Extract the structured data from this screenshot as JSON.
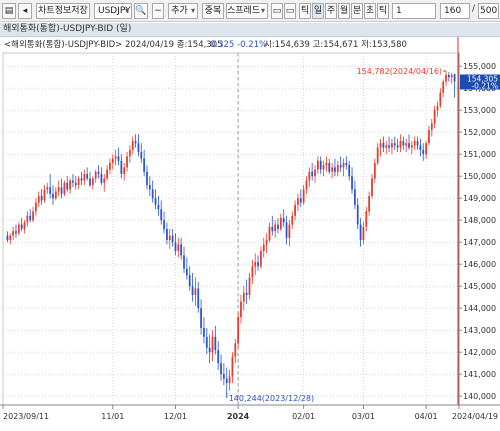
{
  "toolbar": {
    "btn_chart_save": "차트정보저장",
    "symbol": "USDJPY",
    "btn_add": "추가",
    "btn_overlap": "중복",
    "btn_spread": "스프레드",
    "periods": [
      "틱",
      "일",
      "주",
      "월",
      "분",
      "초",
      "틱"
    ],
    "tick_value": "1",
    "count_value": "160",
    "count_sep": "/",
    "count_max": "500"
  },
  "panel_title": "해외통화(통합)-USDJPY-BID (일)",
  "legend": {
    "series": "<해외통화(통합)-USDJPY-BID> 2024/04/19 종:154,305",
    "change": "0.325  -0.21%",
    "ohl": "시:154,639 고:154,671 저:153,580"
  },
  "annotations": {
    "high": "154,782(2024/04/16)",
    "low": "140,244(2023/12/28)"
  },
  "price_tag": {
    "price": "154,305",
    "pct": "-0.21%"
  },
  "colors": {
    "up": "#e23c2e",
    "down": "#2a55c8",
    "tag": "#1d4bb4",
    "cursor": "#d0312d"
  },
  "chart_data": {
    "type": "candlestick",
    "title": "해외통화(통합)-USDJPY-BID (일)",
    "ylim": [
      139.6,
      155.6
    ],
    "yticks": [
      140,
      141,
      142,
      143,
      144,
      145,
      146,
      147,
      148,
      149,
      150,
      151,
      152,
      153,
      154,
      155
    ],
    "ytick_labels": [
      "140,000",
      "141,000",
      "142,000",
      "143,000",
      "144,000",
      "145,000",
      "146,000",
      "147,000",
      "148,000",
      "149,000",
      "150,000",
      "151,000",
      "152,000",
      "153,000",
      "154,000",
      "155,000"
    ],
    "x_labels": [
      {
        "label": "2023/09/11",
        "index": 0
      },
      {
        "label": "11/01",
        "index": 37
      },
      {
        "label": "12/01",
        "index": 59
      },
      {
        "label": "2024",
        "index": 81
      },
      {
        "label": "02/01",
        "index": 104
      },
      {
        "label": "03/01",
        "index": 125
      },
      {
        "label": "04/01",
        "index": 147
      },
      {
        "label": "2024/04/19",
        "index": 160
      }
    ],
    "ohlc": [
      [
        147.3,
        147.5,
        147.0,
        147.1
      ],
      [
        147.1,
        147.4,
        146.9,
        147.3
      ],
      [
        147.3,
        147.7,
        147.1,
        147.5
      ],
      [
        147.5,
        147.8,
        147.2,
        147.4
      ],
      [
        147.4,
        147.9,
        147.3,
        147.8
      ],
      [
        147.8,
        148.1,
        147.5,
        147.6
      ],
      [
        147.6,
        148.0,
        147.4,
        147.9
      ],
      [
        147.9,
        148.4,
        147.7,
        148.2
      ],
      [
        148.2,
        148.5,
        147.9,
        148.0
      ],
      [
        148.0,
        148.6,
        147.9,
        148.4
      ],
      [
        148.4,
        149.0,
        148.2,
        148.8
      ],
      [
        148.8,
        149.3,
        148.6,
        149.1
      ],
      [
        149.1,
        149.4,
        148.7,
        148.9
      ],
      [
        148.9,
        149.6,
        148.8,
        149.4
      ],
      [
        149.4,
        149.7,
        149.2,
        149.5
      ],
      [
        149.5,
        150.1,
        149.0,
        149.2
      ],
      [
        149.2,
        149.6,
        148.7,
        149.0
      ],
      [
        149.0,
        149.5,
        148.9,
        149.3
      ],
      [
        149.3,
        149.8,
        149.1,
        149.5
      ],
      [
        149.5,
        149.9,
        149.0,
        149.2
      ],
      [
        149.2,
        149.8,
        149.1,
        149.7
      ],
      [
        149.7,
        150.0,
        149.3,
        149.4
      ],
      [
        149.4,
        149.9,
        149.2,
        149.8
      ],
      [
        149.8,
        150.1,
        149.5,
        149.7
      ],
      [
        149.7,
        150.0,
        149.4,
        149.6
      ],
      [
        149.6,
        150.0,
        149.4,
        149.9
      ],
      [
        149.9,
        150.2,
        149.6,
        149.8
      ],
      [
        149.8,
        150.3,
        149.6,
        150.1
      ],
      [
        150.1,
        150.4,
        149.8,
        149.9
      ],
      [
        149.9,
        150.2,
        149.5,
        149.6
      ],
      [
        149.6,
        150.0,
        149.4,
        149.9
      ],
      [
        149.9,
        150.3,
        149.7,
        150.2
      ],
      [
        150.2,
        150.5,
        149.9,
        150.1
      ],
      [
        150.1,
        150.4,
        149.6,
        149.7
      ],
      [
        149.7,
        150.1,
        149.3,
        149.9
      ],
      [
        149.9,
        150.5,
        149.8,
        150.3
      ],
      [
        150.3,
        150.8,
        150.1,
        150.6
      ],
      [
        150.6,
        151.0,
        150.3,
        150.8
      ],
      [
        150.8,
        151.2,
        150.5,
        150.9
      ],
      [
        150.9,
        151.3,
        150.5,
        150.7
      ],
      [
        150.7,
        151.0,
        149.9,
        150.1
      ],
      [
        150.1,
        150.6,
        149.8,
        150.4
      ],
      [
        150.4,
        151.1,
        150.2,
        150.9
      ],
      [
        150.9,
        151.4,
        150.6,
        151.2
      ],
      [
        151.2,
        151.8,
        151.0,
        151.6
      ],
      [
        151.6,
        151.9,
        151.3,
        151.5
      ],
      [
        151.5,
        151.9,
        150.9,
        151.1
      ],
      [
        151.1,
        151.5,
        150.6,
        150.8
      ],
      [
        150.8,
        151.2,
        150.0,
        150.2
      ],
      [
        150.2,
        150.5,
        149.4,
        149.6
      ],
      [
        149.6,
        150.0,
        149.1,
        149.4
      ],
      [
        149.4,
        149.8,
        148.8,
        149.0
      ],
      [
        149.0,
        149.4,
        148.5,
        148.7
      ],
      [
        148.7,
        149.1,
        148.2,
        148.5
      ],
      [
        148.5,
        148.9,
        147.8,
        148.0
      ],
      [
        148.0,
        148.4,
        147.4,
        147.6
      ],
      [
        147.6,
        147.9,
        146.9,
        147.1
      ],
      [
        147.1,
        147.6,
        146.7,
        147.3
      ],
      [
        147.3,
        147.6,
        146.8,
        147.0
      ],
      [
        147.0,
        147.4,
        146.4,
        146.6
      ],
      [
        146.6,
        147.2,
        146.3,
        146.9
      ],
      [
        146.9,
        147.2,
        146.2,
        146.4
      ],
      [
        146.4,
        146.8,
        145.6,
        145.8
      ],
      [
        145.8,
        146.3,
        145.3,
        145.5
      ],
      [
        145.5,
        145.9,
        144.8,
        145.0
      ],
      [
        145.0,
        145.6,
        144.3,
        144.6
      ],
      [
        144.6,
        145.4,
        144.1,
        144.9
      ],
      [
        144.9,
        145.2,
        143.8,
        144.0
      ],
      [
        144.0,
        144.4,
        142.8,
        143.1
      ],
      [
        143.1,
        143.6,
        142.4,
        142.7
      ],
      [
        142.7,
        143.1,
        141.9,
        142.2
      ],
      [
        142.2,
        142.8,
        141.5,
        142.0
      ],
      [
        142.0,
        143.0,
        141.6,
        142.7
      ],
      [
        142.7,
        143.2,
        141.9,
        142.1
      ],
      [
        142.1,
        142.5,
        141.2,
        141.5
      ],
      [
        141.5,
        141.9,
        140.7,
        141.0
      ],
      [
        141.0,
        141.5,
        140.5,
        140.8
      ],
      [
        140.8,
        141.3,
        140.2,
        140.6
      ],
      [
        140.6,
        141.2,
        140.24,
        140.9
      ],
      [
        140.9,
        142.0,
        140.6,
        141.8
      ],
      [
        141.8,
        142.6,
        141.5,
        142.4
      ],
      [
        142.4,
        143.8,
        142.2,
        143.6
      ],
      [
        143.6,
        144.6,
        143.3,
        144.3
      ],
      [
        144.3,
        145.0,
        143.9,
        144.7
      ],
      [
        144.7,
        145.3,
        144.2,
        144.6
      ],
      [
        144.6,
        145.6,
        144.4,
        145.4
      ],
      [
        145.4,
        146.2,
        145.1,
        145.9
      ],
      [
        145.9,
        146.5,
        145.5,
        146.1
      ],
      [
        146.1,
        146.4,
        145.7,
        145.9
      ],
      [
        145.9,
        146.8,
        145.8,
        146.6
      ],
      [
        146.6,
        147.2,
        146.3,
        146.9
      ],
      [
        146.9,
        147.4,
        146.5,
        147.1
      ],
      [
        147.1,
        147.9,
        147.0,
        147.7
      ],
      [
        147.7,
        148.2,
        147.3,
        147.5
      ],
      [
        147.5,
        148.0,
        147.2,
        147.8
      ],
      [
        147.8,
        148.1,
        147.4,
        147.6
      ],
      [
        147.6,
        148.3,
        147.5,
        148.1
      ],
      [
        148.1,
        148.5,
        147.7,
        147.9
      ],
      [
        147.9,
        148.2,
        146.9,
        147.2
      ],
      [
        147.2,
        148.0,
        146.8,
        147.8
      ],
      [
        147.8,
        148.4,
        147.6,
        148.2
      ],
      [
        148.2,
        148.9,
        148.0,
        148.7
      ],
      [
        148.7,
        149.2,
        148.4,
        149.0
      ],
      [
        149.0,
        149.4,
        148.6,
        148.8
      ],
      [
        148.8,
        149.6,
        148.7,
        149.4
      ],
      [
        149.4,
        150.0,
        149.2,
        149.8
      ],
      [
        149.8,
        150.4,
        149.5,
        150.2
      ],
      [
        150.2,
        150.6,
        149.8,
        150.0
      ],
      [
        150.0,
        150.5,
        149.7,
        150.3
      ],
      [
        150.3,
        150.9,
        150.1,
        150.7
      ],
      [
        150.7,
        150.9,
        150.1,
        150.3
      ],
      [
        150.3,
        150.7,
        150.0,
        150.5
      ],
      [
        150.5,
        150.9,
        150.2,
        150.6
      ],
      [
        150.6,
        150.8,
        150.1,
        150.2
      ],
      [
        150.2,
        150.6,
        149.9,
        150.4
      ],
      [
        150.4,
        150.8,
        150.0,
        150.2
      ],
      [
        150.2,
        150.7,
        150.0,
        150.5
      ],
      [
        150.5,
        150.9,
        150.2,
        150.4
      ],
      [
        150.4,
        150.8,
        150.0,
        150.6
      ],
      [
        150.6,
        150.9,
        150.3,
        150.5
      ],
      [
        150.5,
        150.7,
        149.8,
        150.0
      ],
      [
        150.0,
        150.4,
        149.2,
        149.4
      ],
      [
        149.4,
        149.8,
        148.5,
        148.7
      ],
      [
        148.7,
        149.0,
        147.6,
        147.8
      ],
      [
        147.8,
        148.1,
        146.8,
        147.1
      ],
      [
        147.1,
        147.9,
        146.9,
        147.7
      ],
      [
        147.7,
        148.6,
        147.5,
        148.4
      ],
      [
        148.4,
        149.3,
        148.2,
        149.1
      ],
      [
        149.1,
        150.1,
        149.0,
        149.9
      ],
      [
        149.9,
        150.8,
        149.7,
        150.6
      ],
      [
        150.6,
        151.5,
        150.5,
        151.3
      ],
      [
        151.3,
        151.7,
        150.9,
        151.5
      ],
      [
        151.5,
        151.8,
        151.1,
        151.3
      ],
      [
        151.3,
        151.6,
        151.0,
        151.4
      ],
      [
        151.4,
        151.8,
        151.1,
        151.3
      ],
      [
        151.3,
        151.7,
        151.0,
        151.5
      ],
      [
        151.5,
        151.8,
        151.2,
        151.4
      ],
      [
        151.4,
        151.7,
        151.1,
        151.3
      ],
      [
        151.3,
        151.9,
        151.1,
        151.6
      ],
      [
        151.6,
        151.8,
        151.2,
        151.4
      ],
      [
        151.4,
        151.7,
        151.1,
        151.5
      ],
      [
        151.5,
        151.9,
        151.2,
        151.3
      ],
      [
        151.3,
        151.6,
        151.0,
        151.4
      ],
      [
        151.4,
        151.8,
        151.2,
        151.6
      ],
      [
        151.6,
        151.8,
        151.2,
        151.4
      ],
      [
        151.4,
        151.7,
        150.9,
        151.2
      ],
      [
        151.2,
        151.5,
        150.7,
        151.0
      ],
      [
        151.0,
        151.6,
        150.8,
        151.5
      ],
      [
        151.5,
        152.3,
        151.4,
        152.1
      ],
      [
        152.1,
        152.6,
        151.8,
        152.4
      ],
      [
        152.4,
        153.2,
        152.2,
        153.0
      ],
      [
        153.0,
        153.4,
        152.7,
        153.2
      ],
      [
        153.2,
        154.0,
        153.1,
        153.8
      ],
      [
        153.8,
        154.4,
        153.6,
        154.3
      ],
      [
        154.3,
        154.78,
        154.1,
        154.6
      ],
      [
        154.6,
        154.74,
        154.3,
        154.5
      ],
      [
        154.5,
        154.7,
        154.2,
        154.6
      ],
      [
        154.639,
        154.671,
        153.58,
        154.305
      ]
    ]
  }
}
